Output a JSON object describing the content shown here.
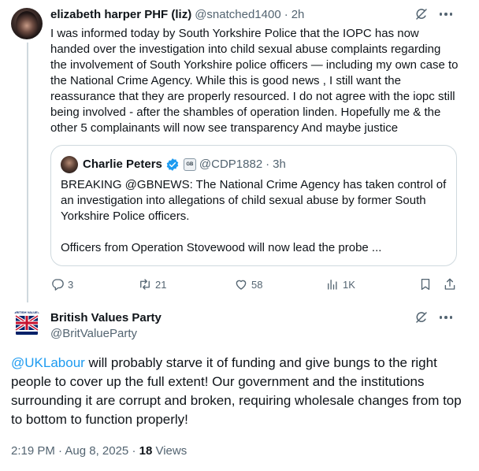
{
  "parent_tweet": {
    "author_name": "elizabeth harper PHF (liz)",
    "author_handle": "@snatched1400",
    "separator": "·",
    "time": "2h",
    "text": "I was informed today by South Yorkshire Police that the IOPC has now handed over the investigation into child sexual abuse complaints regarding the involvement of South Yorkshire police officers — including my own case to the National Crime Agency. While this is good news , I still want the reassurance that they are properly resourced. I do not agree with the iopc still being involved - after the shambles of operation linden. Hopefully me & the other 5 complainants will now see transparency And maybe justice",
    "quote": {
      "author_name": "Charlie Peters",
      "badge_text": "GB",
      "author_handle": "@CDP1882",
      "separator": "·",
      "time": "3h",
      "paragraph_1": "BREAKING @GBNEWS: The National Crime Agency has taken control of an investigation into allegations of child sexual abuse by former South Yorkshire Police officers.",
      "paragraph_2": "Officers from Operation Stovewood will now lead the probe ..."
    },
    "actions": {
      "replies": "3",
      "reposts": "21",
      "likes": "58",
      "views": "1K"
    }
  },
  "main_tweet": {
    "author_name": "British Values Party",
    "author_handle": "@BritValueParty",
    "mention": "@UKLabour",
    "text_after_mention": " will probably starve it of funding and give bungs to the right people to cover up the full extent! Our government and the institutions surrounding it are corrupt and broken, requiring wholesale changes from top to bottom to function properly!",
    "timestamp": "2:19 PM · Aug 8, 2025",
    "meta_separator": " · ",
    "views_count": "18",
    "views_label": " Views",
    "avatar_banner_text": "BRITISH VALUES"
  },
  "colors": {
    "text": "#0f1419",
    "secondary": "#536471",
    "link": "#1d9bf0",
    "border": "#cfd9de",
    "verified": "#1d9bf0"
  }
}
